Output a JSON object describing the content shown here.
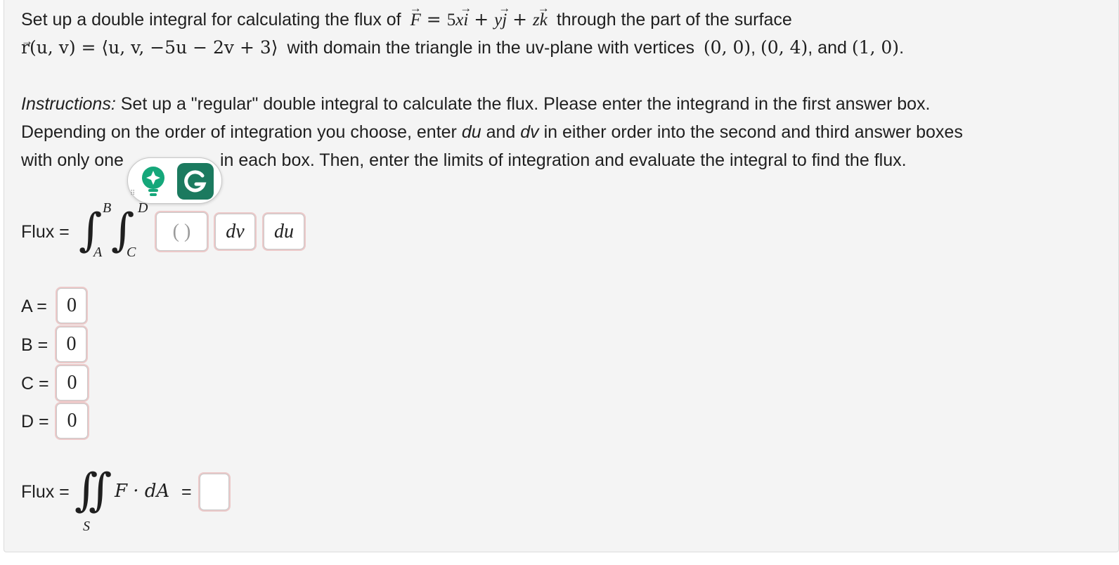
{
  "question": {
    "intro": "Set up a double integral for calculating the flux of",
    "field_lhs": "F",
    "field_rhs_coef": "5",
    "field_x": "x",
    "field_i": "i",
    "field_y": "y",
    "field_j": "j",
    "field_z": "z",
    "field_k": "k",
    "through_text": "through the part of the surface",
    "surface_lhs": "r(u, v) = ⟨u, v, −5u − 2v + 3⟩",
    "domain_text": "with domain the triangle in the uv-plane with vertices",
    "vertex_1": "(0, 0)",
    "vertex_2": "(0, 4)",
    "vertex_3": "(1, 0)",
    "and_text": "and",
    "instructions_label": "Instructions:",
    "instructions_1": "Set up a \"regular\" double integral to calculate the flux. Please enter the integrand in the first answer box.",
    "instructions_2a": "Depending on the order of integration you choose, enter",
    "instructions_du": "du",
    "instructions_and": "and",
    "instructions_dv": "dv",
    "instructions_2b": "in either order into the second and third answer boxes",
    "instructions_3a": "with only one",
    "instructions_3b": "in each box. Then, enter the limits of integration and evaluate the integral to find the flux."
  },
  "integral_setup": {
    "flux_label": "Flux =",
    "upper_outer": "B",
    "lower_outer": "A",
    "upper_inner": "D",
    "lower_inner": "C",
    "integrand_value": "( )",
    "diff_1_value": "dv",
    "diff_2_value": "du"
  },
  "limits": [
    {
      "label": "A =",
      "value": "0"
    },
    {
      "label": "B =",
      "value": "0"
    },
    {
      "label": "C =",
      "value": "0"
    },
    {
      "label": "D =",
      "value": "0"
    }
  ],
  "final": {
    "flux_label": "Flux =",
    "surface_sub": "S",
    "expression": "F · dA",
    "equals": "=",
    "answer_value": ""
  },
  "grammarly": {
    "icons": [
      "lightbulb-icon",
      "grammarly-g-icon"
    ],
    "accent": "#15a77a",
    "g_bg": "#1b7a5f"
  }
}
